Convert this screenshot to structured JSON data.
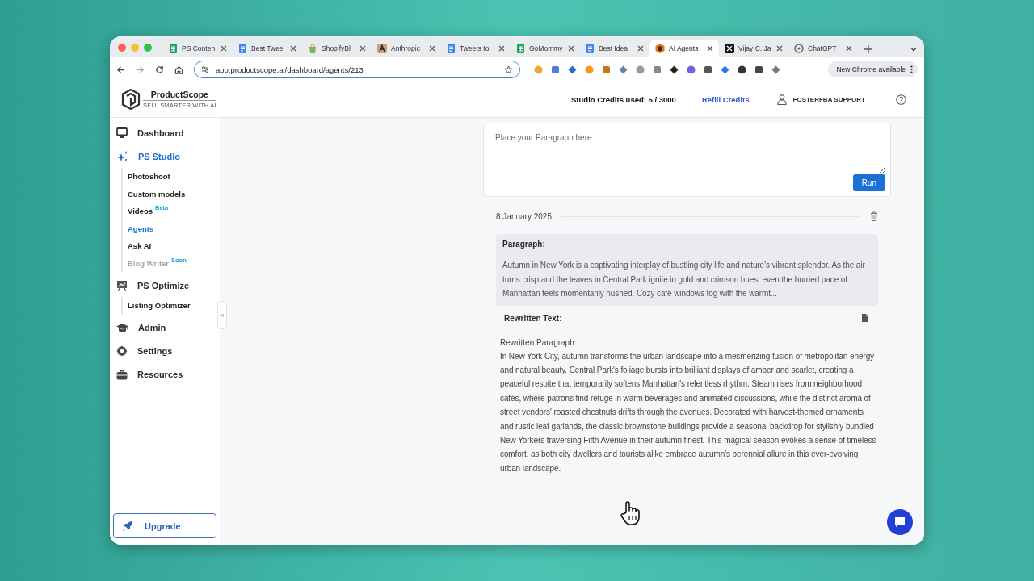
{
  "browser": {
    "tabs": [
      {
        "title": "PS Conten",
        "kind": "sheet",
        "selected": false
      },
      {
        "title": "Best Twee",
        "kind": "doc",
        "selected": false
      },
      {
        "title": "ShopifyBl",
        "kind": "shopify",
        "selected": false
      },
      {
        "title": "Anthropic",
        "kind": "anthropic",
        "selected": false
      },
      {
        "title": "Tweets to",
        "kind": "doc",
        "selected": false
      },
      {
        "title": "GoMommy",
        "kind": "sheet",
        "selected": false
      },
      {
        "title": "Best Idea",
        "kind": "doc",
        "selected": false
      },
      {
        "title": "AI Agents",
        "kind": "productscope",
        "selected": true
      },
      {
        "title": "Vijay C. Ja",
        "kind": "x",
        "selected": false
      },
      {
        "title": "ChatGPT",
        "kind": "chatgpt",
        "selected": false
      }
    ],
    "url": "app.productscope.ai/dashboard/agents/213",
    "update_button": "New Chrome available"
  },
  "header": {
    "brand": "ProductScope",
    "tagline": "SELL SMARTER WITH AI",
    "credits": "Studio Credits used: 5 / 3000",
    "refill": "Refill Credits",
    "account": "FOSTERFBA SUPPORT"
  },
  "sidebar": {
    "items": [
      {
        "label": "Dashboard",
        "kind": "dashboard",
        "selected": false
      },
      {
        "label": "PS Studio",
        "kind": "studio",
        "selected": true,
        "children": [
          {
            "label": "Photoshoot",
            "selected": false,
            "disabled": false
          },
          {
            "label": "Custom models",
            "selected": false,
            "disabled": false
          },
          {
            "label": "Videos",
            "badge": "Beta",
            "selected": false,
            "disabled": false
          },
          {
            "label": "Agents",
            "selected": true,
            "disabled": false
          },
          {
            "label": "Ask AI",
            "selected": false,
            "disabled": false
          },
          {
            "label": "Blog Writer",
            "badge": "Soon",
            "selected": false,
            "disabled": true
          }
        ]
      },
      {
        "label": "PS Optimize",
        "kind": "optimize",
        "selected": false,
        "children": [
          {
            "label": "Listing Optimizer",
            "selected": false,
            "disabled": false
          }
        ]
      },
      {
        "label": "Admin",
        "kind": "admin",
        "selected": false
      },
      {
        "label": "Settings",
        "kind": "settings",
        "selected": false
      },
      {
        "label": "Resources",
        "kind": "resources",
        "selected": false
      }
    ],
    "upgrade": "Upgrade"
  },
  "main": {
    "input": {
      "placeholder": "Place your Paragraph here"
    },
    "run_button": "Run",
    "entries": [
      {
        "date": "8 January 2025",
        "paragraph_label": "Paragraph:",
        "paragraph": "Autumn in New York is a captivating interplay of bustling city life and nature’s vibrant splendor. As the air turns crisp and the leaves in Central Park ignite in gold and crimson hues, even the hurried pace of Manhattan feels momentarily hushed. Cozy café windows fog with the warmt...",
        "rewritten_label": "Rewritten Text:",
        "rewritten_heading": "Rewritten Paragraph:",
        "rewritten": "In New York City, autumn transforms the urban landscape into a mesmerizing fusion of metropolitan energy and natural beauty. Central Park's foliage bursts into brilliant displays of amber and scarlet, creating a peaceful respite that temporarily softens Manhattan's relentless rhythm. Steam rises from neighborhood cafés, where patrons find refuge in warm beverages and animated discussions, while the distinct aroma of street vendors' roasted chestnuts drifts through the avenues. Decorated with harvest-themed ornaments and rustic leaf garlands, the classic brownstone buildings provide a seasonal backdrop for stylishly bundled New Yorkers traversing Fifth Avenue in their autumn finest. This magical season evokes a sense of timeless comfort, as both city dwellers and tourists alike embrace autumn's perennial allure in this ever-evolving urban landscape."
      }
    ]
  }
}
